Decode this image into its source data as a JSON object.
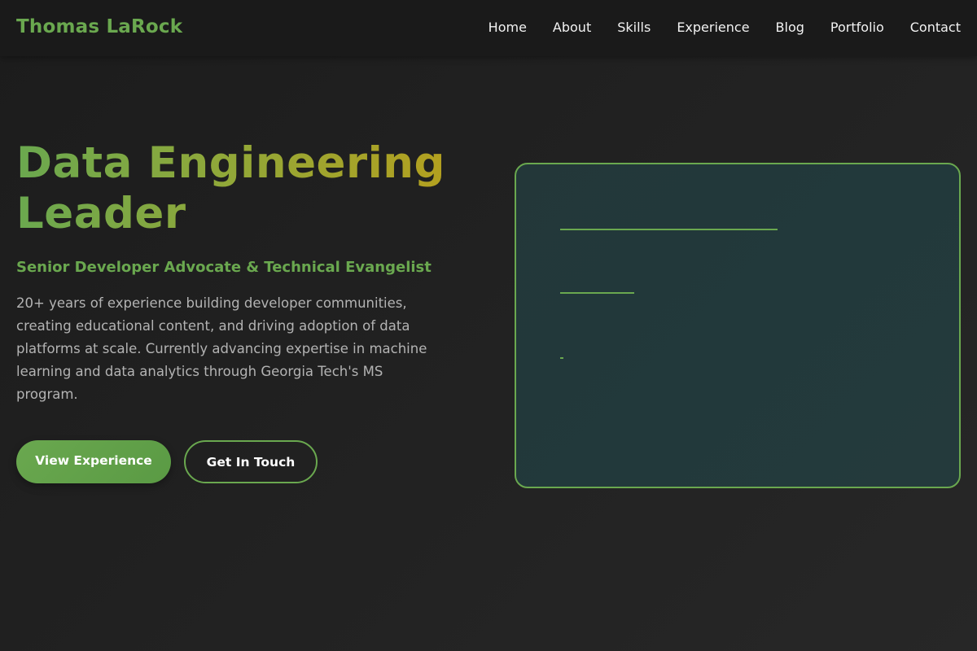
{
  "nav": {
    "brand": "Thomas LaRock",
    "links": [
      "Home",
      "About",
      "Skills",
      "Experience",
      "Blog",
      "Portfolio",
      "Contact"
    ]
  },
  "hero": {
    "title_line1": "Data Engineering",
    "title_line2": "Leader",
    "subtitle": "Senior Developer Advocate & Technical Evangelist",
    "description": "20+ years of experience building developer communities, creating educational content, and driving adoption of data platforms at scale. Currently advancing expertise in machine learning and data analytics through Georgia Tech's MS program.",
    "primary_button": "View Experience",
    "secondary_button": "Get In Touch"
  },
  "colors": {
    "accent": "#6aa84f",
    "gold": "#b5a01e",
    "background": "#1f1f1f",
    "card_background": "#233739",
    "text_muted": "#b3b3b3"
  }
}
